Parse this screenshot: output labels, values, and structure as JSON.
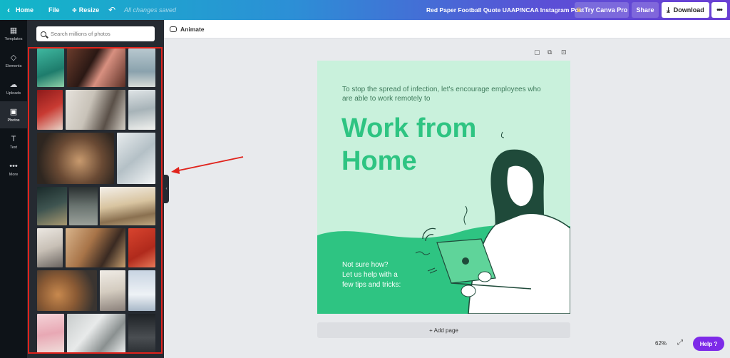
{
  "topbar": {
    "home_label": "Home",
    "file_label": "File",
    "resize_label": "Resize",
    "saved_status": "All changes saved",
    "design_title": "Red Paper Football Quote UAAP/NCAA Instagram Post",
    "try_pro_label": "Try Canva Pro",
    "share_label": "Share",
    "download_label": "Download"
  },
  "rail": {
    "items": [
      {
        "label": "Templates",
        "icon": "templates-icon"
      },
      {
        "label": "Elements",
        "icon": "elements-icon"
      },
      {
        "label": "Uploads",
        "icon": "uploads-icon"
      },
      {
        "label": "Photos",
        "icon": "photos-icon"
      },
      {
        "label": "Text",
        "icon": "text-icon"
      },
      {
        "label": "More",
        "icon": "more-icon"
      }
    ]
  },
  "panel": {
    "search_placeholder": "Search millions of photos"
  },
  "editor": {
    "animate_label": "Animate",
    "add_page_label": "+ Add page",
    "zoom_level": "62%",
    "help_label": "Help  ?"
  },
  "design": {
    "small_text": "To stop the spread of infection, let's encourage employees who are able to work remotely to",
    "headline_line1": "Work from",
    "headline_line2": "Home",
    "help_line1": "Not sure how?",
    "help_line2": "Let us help with a",
    "help_line3": "few tips and tricks:",
    "colors": {
      "background": "#c9f1dc",
      "accent": "#2ec482",
      "figure": "#1f4a3a"
    }
  },
  "colors": {
    "highlight_border": "#e0231c",
    "help_button": "#7d2ae8",
    "rail_bg": "#0e1318",
    "panel_bg": "#252a31"
  }
}
